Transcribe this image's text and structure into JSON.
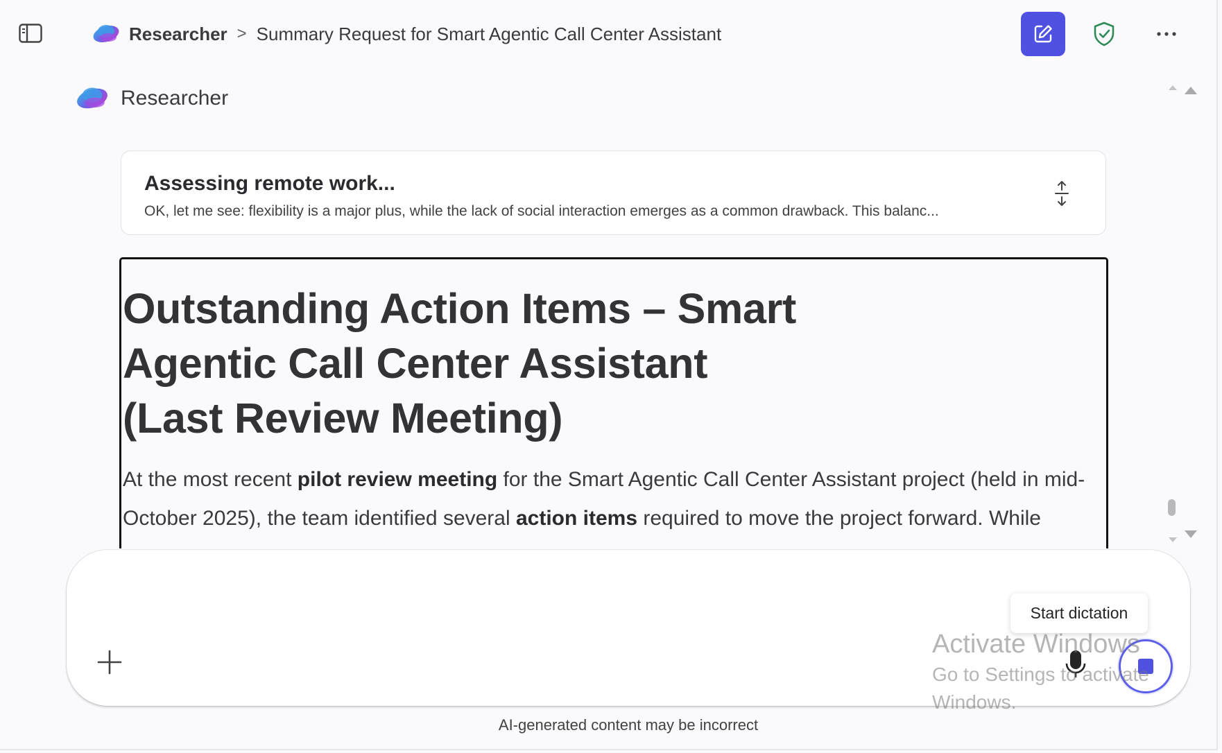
{
  "header": {
    "agent_name": "Researcher",
    "separator": ">",
    "conversation_title": "Summary Request for Smart Agentic Call Center Assistant",
    "icons": {
      "sidebar_toggle": "sidebar-toggle-icon",
      "new_chat": "compose-icon",
      "shield": "shield-check-icon",
      "more": "more-horizontal-icon"
    }
  },
  "agent": {
    "name": "Researcher"
  },
  "progress": {
    "title": "Assessing remote work...",
    "description": "OK, let me see: flexibility is a major plus, while the lack of social interaction emerges as a common drawback. This balanc..."
  },
  "response": {
    "title": "Outstanding Action Items – Smart Agentic Call Center Assistant (Last Review Meeting)",
    "body": [
      {
        "text": "At the most recent ",
        "bold": false
      },
      {
        "text": "pilot review meeting",
        "bold": true
      },
      {
        "text": " for the Smart Agentic Call Center Assistant project (held in mid-October 2025), the team identified several ",
        "bold": false
      },
      {
        "text": "action items",
        "bold": true
      },
      {
        "text": " required to move the project forward. While several phases have completed to enable AI assistance, a full integration with the rest",
        "bold": false
      }
    ]
  },
  "composer": {
    "placeholder": "",
    "tooltip": "Start dictation"
  },
  "watermark": {
    "title": "Activate Windows",
    "subtitle": "Go to Settings to activate Windows."
  },
  "footer": {
    "disclaimer": "AI-generated content may be incorrect"
  },
  "colors": {
    "accent": "#4f52e0",
    "shield": "#2e8b57",
    "background": "#faf9fb"
  }
}
